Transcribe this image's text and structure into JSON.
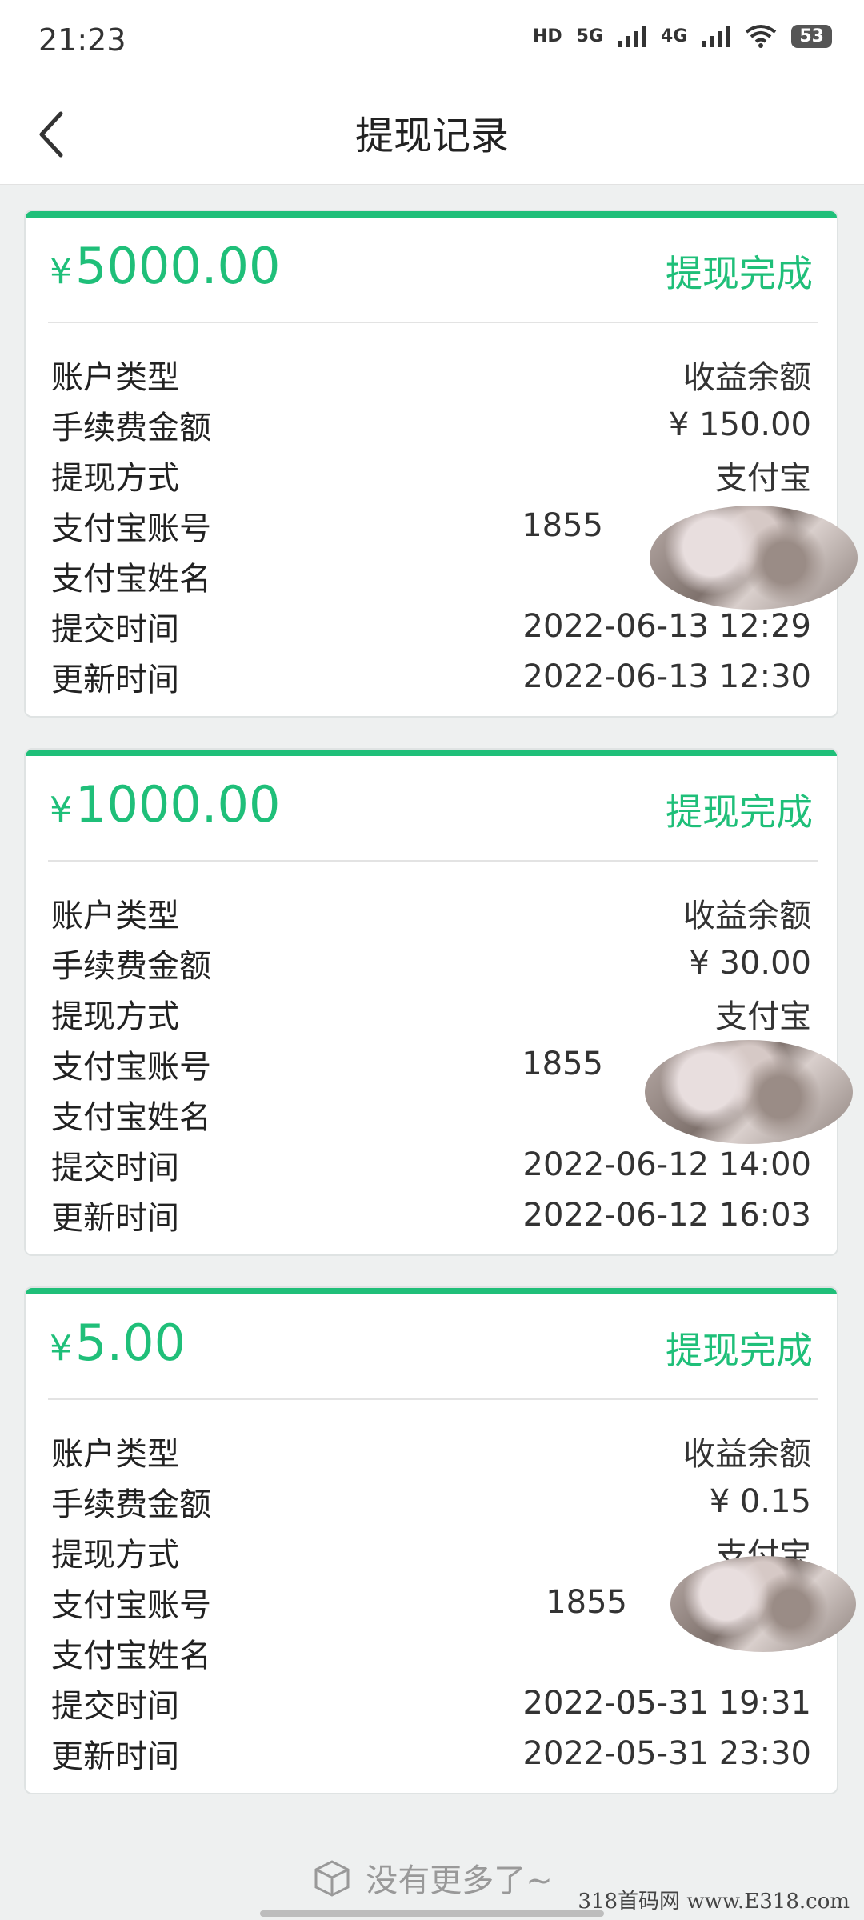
{
  "status_bar": {
    "time": "21:23",
    "hd": "HD",
    "net1": "5G",
    "net2": "4G",
    "battery": "53"
  },
  "header": {
    "title": "提现记录"
  },
  "records": [
    {
      "amount": "5000.00",
      "currency": "¥",
      "status": "提现完成",
      "rows": [
        {
          "label": "账户类型",
          "value": "收益余额"
        },
        {
          "label": "手续费金额",
          "value": "¥ 150.00"
        },
        {
          "label": "提现方式",
          "value": "支付宝"
        },
        {
          "label": "支付宝账号",
          "value": "1855"
        },
        {
          "label": "支付宝姓名",
          "value": ""
        },
        {
          "label": "提交时间",
          "value": "2022-06-13 12:29"
        },
        {
          "label": "更新时间",
          "value": "2022-06-13 12:30"
        }
      ]
    },
    {
      "amount": "1000.00",
      "currency": "¥",
      "status": "提现完成",
      "rows": [
        {
          "label": "账户类型",
          "value": "收益余额"
        },
        {
          "label": "手续费金额",
          "value": "¥ 30.00"
        },
        {
          "label": "提现方式",
          "value": "支付宝"
        },
        {
          "label": "支付宝账号",
          "value": "1855"
        },
        {
          "label": "支付宝姓名",
          "value": ""
        },
        {
          "label": "提交时间",
          "value": "2022-06-12 14:00"
        },
        {
          "label": "更新时间",
          "value": "2022-06-12 16:03"
        }
      ]
    },
    {
      "amount": "5.00",
      "currency": "¥",
      "status": "提现完成",
      "rows": [
        {
          "label": "账户类型",
          "value": "收益余额"
        },
        {
          "label": "手续费金额",
          "value": "¥ 0.15"
        },
        {
          "label": "提现方式",
          "value": "支付宝"
        },
        {
          "label": "支付宝账号",
          "value": "1855"
        },
        {
          "label": "支付宝姓名",
          "value": ""
        },
        {
          "label": "提交时间",
          "value": "2022-05-31 19:31"
        },
        {
          "label": "更新时间",
          "value": "2022-05-31 23:30"
        }
      ]
    }
  ],
  "footer": {
    "text": "没有更多了~",
    "icon": "empty-box-icon"
  },
  "watermark": "318首码网 www.E318.com",
  "colors": {
    "accent": "#1fbf79",
    "background": "#eef0f0"
  }
}
